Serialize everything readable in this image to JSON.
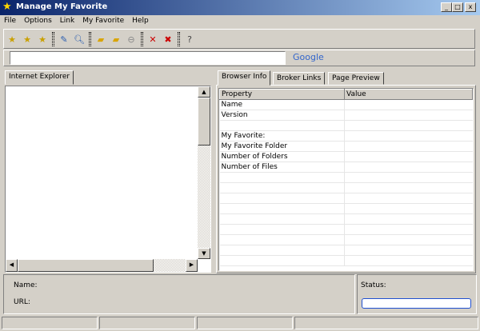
{
  "window": {
    "title": "Manage My Favorite",
    "min": "_",
    "max": "□",
    "close": "x"
  },
  "menu": [
    "File",
    "Options",
    "Link",
    "My Favorite",
    "Help"
  ],
  "search": {
    "value": "",
    "brand": "Google"
  },
  "left_tab": "Internet Explorer",
  "right_tabs": [
    "Browser Info",
    "Broker Links",
    "Page Preview"
  ],
  "table": {
    "headers": [
      "Property",
      "Value"
    ],
    "rows": [
      [
        "Name",
        ""
      ],
      [
        "Version",
        ""
      ],
      [
        "",
        ""
      ],
      [
        "My Favorite:",
        ""
      ],
      [
        "My Favorite Folder",
        ""
      ],
      [
        "Number of Folders",
        ""
      ],
      [
        "Number of Files",
        ""
      ],
      [
        "",
        ""
      ],
      [
        "",
        ""
      ],
      [
        "",
        ""
      ],
      [
        "",
        ""
      ],
      [
        "",
        ""
      ],
      [
        "",
        ""
      ],
      [
        "",
        ""
      ],
      [
        "",
        ""
      ],
      [
        "",
        ""
      ]
    ]
  },
  "details": {
    "name_label": "Name:",
    "url_label": "URL:",
    "status_label": "Status:"
  }
}
